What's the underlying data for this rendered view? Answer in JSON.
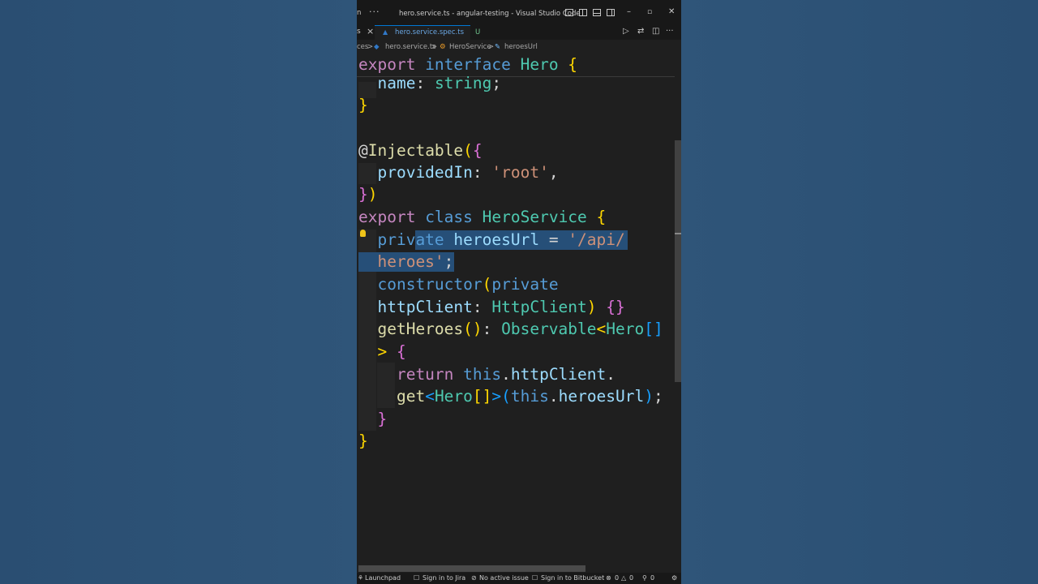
{
  "window": {
    "title": "hero.service.ts - angular-testing - Visual Studio Code",
    "title_fragment": "n"
  },
  "tabs": {
    "prev_fragment": "s",
    "active_label": "hero.service.spec.ts",
    "active_badge": "U"
  },
  "breadcrumb": {
    "items": [
      "ces",
      "hero.service.ts",
      "HeroService",
      "heroesUrl"
    ],
    "separator": ">"
  },
  "colors": {
    "keyword": "#569cd6",
    "control": "#c586c0",
    "type": "#4ec9b0",
    "function": "#dcdcaa",
    "variable": "#9cdcfe",
    "string": "#ce9178",
    "selection": "#264f78",
    "accent": "#0078d4"
  },
  "code_lines": [
    "export interface Hero {",
    "  name: string;",
    "}",
    "",
    "@Injectable({",
    "  providedIn: 'root',",
    "})",
    "export class HeroService {",
    "  private heroesUrl = '/api/",
    "  heroes';",
    "  constructor(private",
    "  httpClient: HttpClient) {}",
    "  getHeroes(): Observable<Hero[]",
    "  > {",
    "    return this.httpClient.",
    "    get<Hero[]>(this.heroesUrl);",
    "  }",
    "}"
  ],
  "status": {
    "launchpad": "Launchpad",
    "jira": "Sign in to Jira",
    "issue": "No active issue",
    "bitbucket": "Sign in to Bitbucket",
    "errors": "0",
    "warnings": "0",
    "ports": "0"
  },
  "icons": [
    "more-icon",
    "layout-icon",
    "split-icon",
    "panel-icon",
    "sidebar-icon",
    "minimize-icon",
    "maximize-icon",
    "close-icon",
    "run-icon",
    "compare-icon",
    "split-editor-icon",
    "lightbulb-icon",
    "error-icon",
    "warning-icon",
    "ports-icon"
  ]
}
